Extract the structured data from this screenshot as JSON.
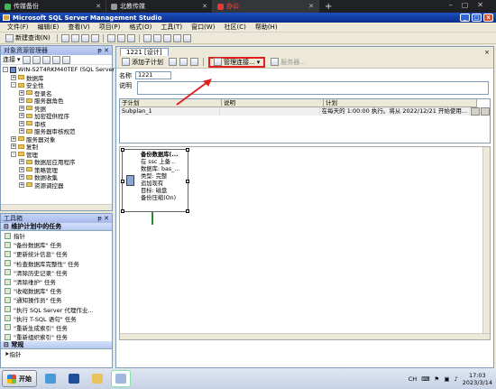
{
  "browser": {
    "tabs": [
      {
        "label": "传媒备份",
        "color": "#3fb950"
      },
      {
        "label": "北教传媒",
        "color": "#999999"
      },
      {
        "label": "办公",
        "color": "#e53935"
      }
    ],
    "new_tab": "+"
  },
  "window": {
    "title": "Microsoft SQL Server Management Studio"
  },
  "menu": [
    "文件(F)",
    "编辑(E)",
    "查看(V)",
    "项目(P)",
    "格式(O)",
    "工具(T)",
    "窗口(W)",
    "社区(C)",
    "帮助(H)"
  ],
  "toolbar": {
    "new_query": "新建查询(N)"
  },
  "object_explorer": {
    "title": "对象资源管理器",
    "connect": "连接",
    "server": "WIN-S2T4RKM40TEF (SQL Server 1",
    "nodes": [
      {
        "label": "数据库",
        "depth": 1,
        "exp": "+"
      },
      {
        "label": "安全性",
        "depth": 1,
        "exp": "-"
      },
      {
        "label": "登录名",
        "depth": 2,
        "exp": "+"
      },
      {
        "label": "服务器角色",
        "depth": 2,
        "exp": "+"
      },
      {
        "label": "凭据",
        "depth": 2,
        "exp": "+"
      },
      {
        "label": "加密提供程序",
        "depth": 2,
        "exp": "+"
      },
      {
        "label": "审核",
        "depth": 2,
        "exp": "+"
      },
      {
        "label": "服务器审核规范",
        "depth": 2,
        "exp": "+"
      },
      {
        "label": "服务器对象",
        "depth": 1,
        "exp": "+"
      },
      {
        "label": "复制",
        "depth": 1,
        "exp": "+"
      },
      {
        "label": "管理",
        "depth": 1,
        "exp": "-"
      },
      {
        "label": "数据层应用程序",
        "depth": 2,
        "exp": "+"
      },
      {
        "label": "策略管理",
        "depth": 2,
        "exp": "+"
      },
      {
        "label": "数据收集",
        "depth": 2,
        "exp": "+"
      },
      {
        "label": "资源调控器",
        "depth": 2,
        "exp": "+"
      }
    ]
  },
  "toolbox": {
    "title": "工具箱",
    "group1": "维护计划中的任务",
    "items": [
      "指针",
      "\"备份数据库\" 任务",
      "\"更新统计信息\" 任务",
      "\"检查数据库完整性\" 任务",
      "\"清除历史记录\" 任务",
      "\"清除维护\" 任务",
      "\"收缩数据库\" 任务",
      "\"通知操作员\" 任务",
      "\"执行 SQL Server 代理作业...",
      "\"执行 T-SQL 语句\" 任务",
      "\"重新生成索引\" 任务",
      "\"重新组织索引\" 任务"
    ],
    "group2": "常规",
    "general_items": [
      "指针"
    ]
  },
  "document": {
    "tab_label": "1221 [设计]",
    "close": "×",
    "add_subplan": "添加子计划",
    "manage_connections": "管理连接...",
    "server_btn": "服务器...",
    "name_label": "名称",
    "name_value": "1221",
    "desc_label": "说明",
    "grid_headers": [
      "子计划",
      "说明",
      "计划"
    ],
    "grid_row": [
      "Subplan_1",
      "",
      "在每天的 1:00:00 执行。将从 2022/12/21 开始使用..."
    ]
  },
  "task_box": {
    "lines": [
      "备份数据库(...",
      "在 ssc 上备...",
      "数据库: bas_...",
      "类型: 完整",
      "追加现有",
      "目标: 磁盘",
      "备份压缩(On)"
    ]
  },
  "status": "就绪",
  "taskbar": {
    "start": "开始",
    "tray_lang": "CH",
    "time": "17:03",
    "date": "2023/3/14"
  },
  "colors": {
    "highlight_box": "#e02020",
    "arrow": "#e02020"
  }
}
